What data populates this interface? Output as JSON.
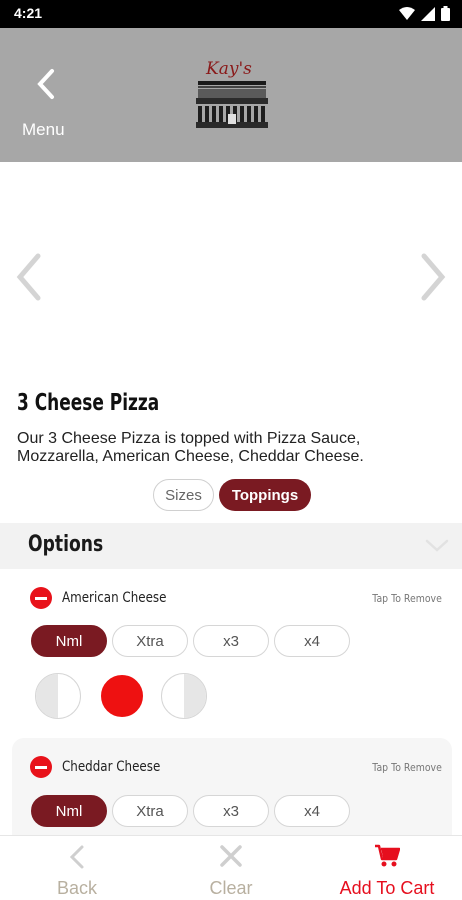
{
  "status_bar": {
    "time": "4:21"
  },
  "header": {
    "back_label": "Menu",
    "logo_text": "Kay's",
    "icon": "chevron-left-icon"
  },
  "item": {
    "title": "3 Cheese Pizza",
    "description": "Our 3 Cheese Pizza is topped with Pizza Sauce, Mozzarella, American Cheese, Cheddar Cheese."
  },
  "tabs": [
    {
      "label": "Sizes",
      "selected": false
    },
    {
      "label": "Toppings",
      "selected": true
    }
  ],
  "options": {
    "title": "Options",
    "toppings": [
      {
        "name": "American Cheese",
        "action": "Tap To Remove",
        "amounts": [
          "Nml",
          "Xtra",
          "x3",
          "x4"
        ],
        "selected_amount": "Nml",
        "coverage": "whole"
      },
      {
        "name": "Cheddar Cheese",
        "action": "Tap To Remove",
        "amounts": [
          "Nml",
          "Xtra",
          "x3",
          "x4"
        ],
        "selected_amount": "Nml"
      }
    ]
  },
  "bottom_bar": {
    "back_label": "Back",
    "clear_label": "Clear",
    "cart_label": "Add To Cart"
  },
  "colors": {
    "accent": "#7a1a22",
    "red": "#e8121a",
    "header_bg": "#a7a7a7"
  }
}
